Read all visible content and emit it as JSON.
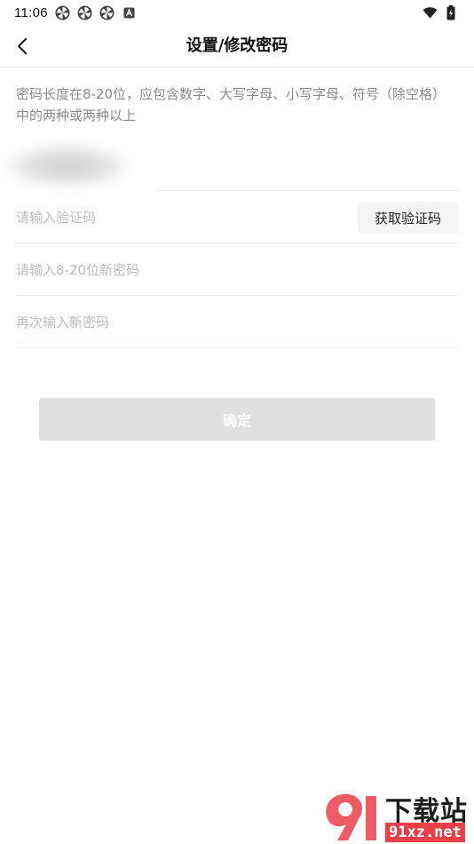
{
  "status_bar": {
    "time": "11:06",
    "left_icons": [
      "pinwheel-icon",
      "pinwheel-icon",
      "pinwheel-icon",
      "a-box-icon"
    ],
    "right_icons": [
      "wifi-icon",
      "battery-charging-icon"
    ]
  },
  "nav": {
    "title": "设置/修改密码",
    "back_icon": "chevron-left-icon"
  },
  "hint": "密码长度在8-20位，应包含数字、大写字母、小写字母、符号（除空格）中的两种或两种以上",
  "form": {
    "code_placeholder": "请输入验证码",
    "get_code_label": "获取验证码",
    "new_password_placeholder": "请输入8-20位新密码",
    "confirm_password_placeholder": "再次输入新密码"
  },
  "confirm_label": "确定",
  "watermark": {
    "title": "下载站",
    "site": "91xz.net"
  },
  "colors": {
    "hint_text": "#8a8a8a",
    "placeholder": "#bdbdbd",
    "divider": "#ececec",
    "button_disabled": "#e0e0e0",
    "get_code_bg": "#f4f4f4",
    "watermark_red": "#e8404a"
  }
}
